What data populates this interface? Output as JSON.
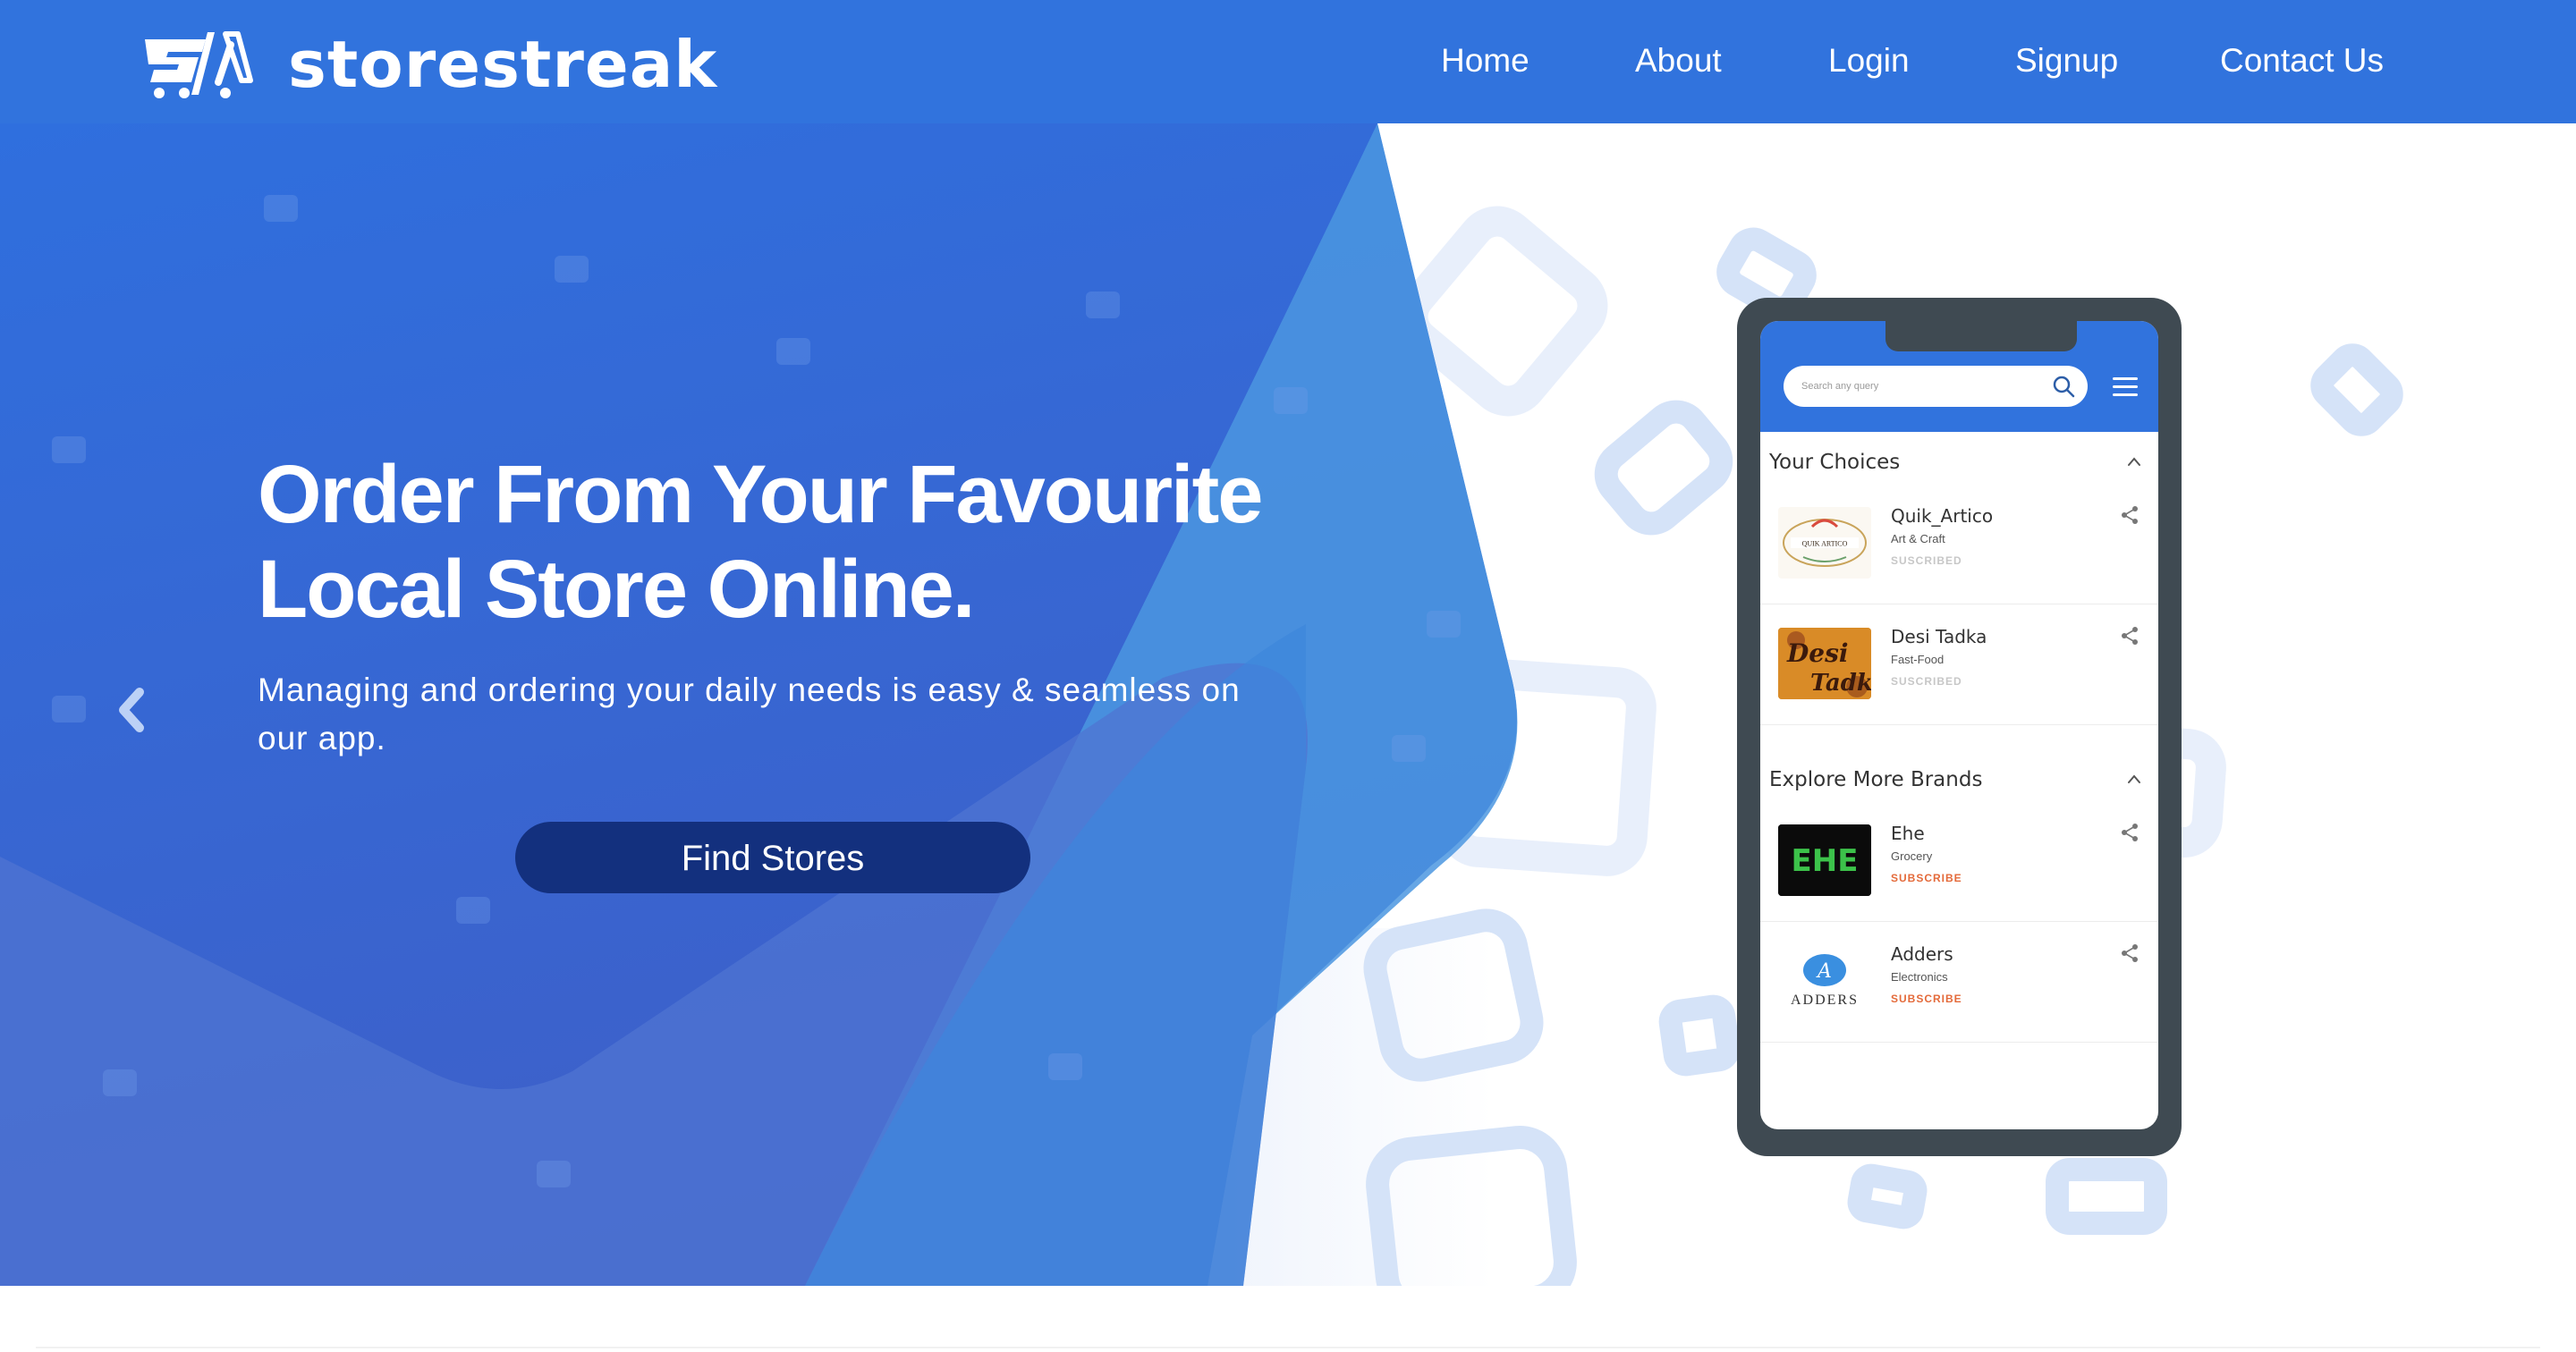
{
  "brand": {
    "name": "storestreak",
    "primary_color": "#3173dd",
    "button_color": "#13307e"
  },
  "nav": {
    "items": [
      {
        "label": "Home"
      },
      {
        "label": "About"
      },
      {
        "label": "Login"
      },
      {
        "label": "Signup"
      },
      {
        "label": "Contact Us"
      }
    ]
  },
  "hero": {
    "title_line1": "Order From Your Favourite",
    "title_line2": "Local Store Online.",
    "subtitle": "Managing and ordering your daily needs is easy & seamless on our app.",
    "cta_label": "Find Stores",
    "prev_icon": "chevron-left-icon"
  },
  "phone_app": {
    "search_placeholder": "Search any query",
    "sections": [
      {
        "title": "Your Choices",
        "stores": [
          {
            "name": "Quik_Artico",
            "category": "Art & Craft",
            "status": "SUSCRIBED"
          },
          {
            "name": "Desi Tadka",
            "category": "Fast-Food",
            "status": "SUSCRIBED"
          }
        ]
      },
      {
        "title": "Explore More Brands",
        "stores": [
          {
            "name": "Ehe",
            "category": "Grocery",
            "status": "SUBSCRIBE"
          },
          {
            "name": "Adders",
            "category": "Electronics",
            "status": "SUBSCRIBE"
          }
        ]
      }
    ],
    "logo_text": {
      "quik_artico": "QUIK ARTICO",
      "desi_tadka_1": "Desi",
      "desi_tadka_2": "Tadka",
      "ehe": "EHE",
      "adders_mark": "A",
      "adders_word": "ADDERS"
    }
  }
}
